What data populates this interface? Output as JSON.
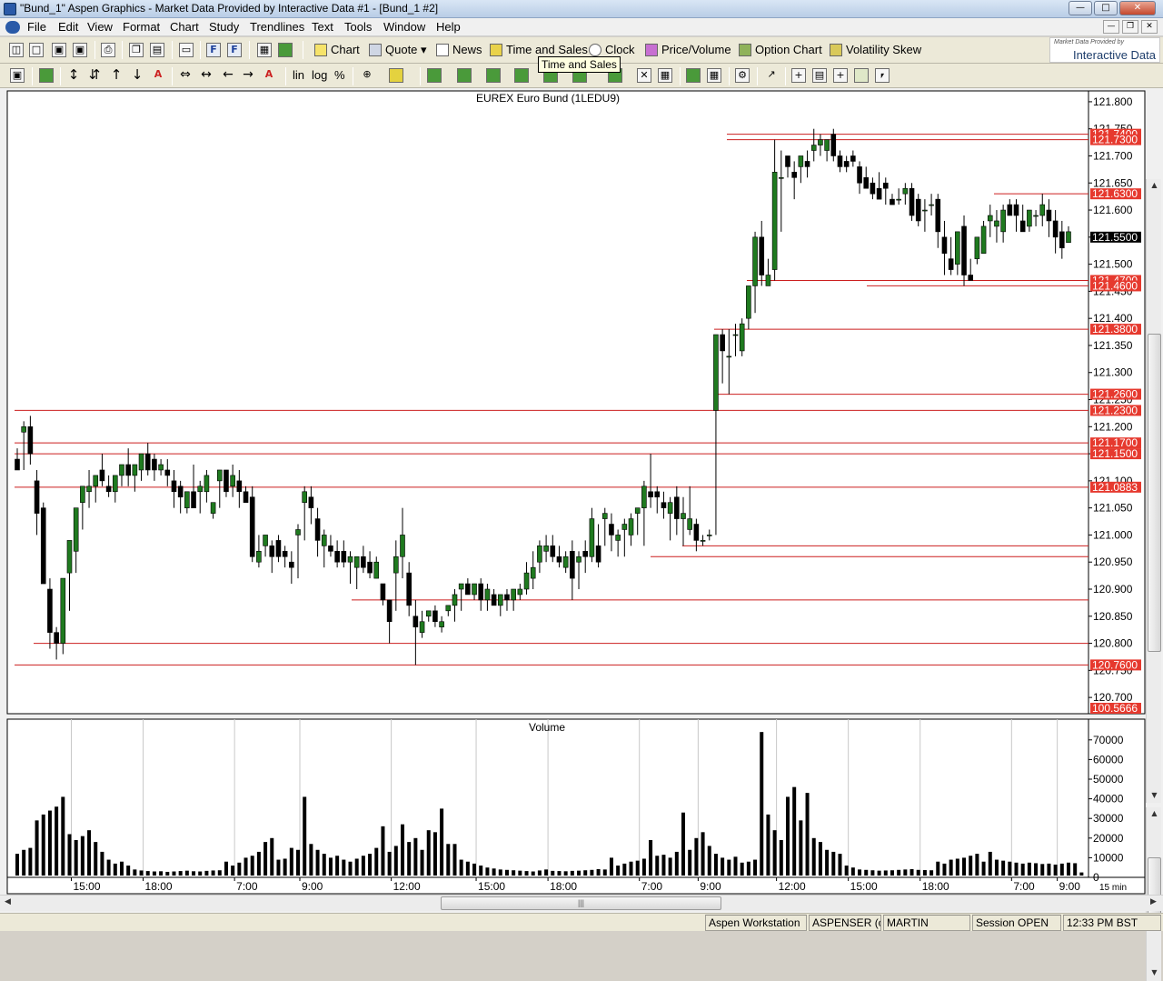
{
  "window": {
    "title": "\"Bund_1\" Aspen Graphics - Market Data Provided by Interactive Data #1 - [Bund_1 #2]"
  },
  "menu": [
    "File",
    "Edit",
    "View",
    "Format",
    "Chart",
    "Study",
    "Trendlines",
    "Text",
    "Tools",
    "Window",
    "Help"
  ],
  "toolbar": {
    "buttons": [
      "Chart",
      "Quote",
      "News",
      "Time and Sales",
      "Clock",
      "Price/Volume",
      "Option Chart",
      "Volatility Skew"
    ],
    "scale_lin": "lin",
    "scale_log": "log",
    "scale_pct": "%"
  },
  "logo": {
    "small": "Market Data Provided by",
    "big": "Interactive Data"
  },
  "tooltip": "Time and Sales",
  "colors": {
    "up": "#1f7a1f",
    "down": "#000000",
    "level": "#cc1f1f",
    "label_bg": "#e6392e",
    "current_bg": "#000000"
  },
  "chart_data": [
    {
      "type": "candlestick",
      "title": "EUREX  Euro  Bund  (1LEDU9)",
      "ylim": [
        120.67,
        121.82
      ],
      "yticks": [
        "121.800",
        "121.750",
        "121.700",
        "121.650",
        "121.600",
        "121.550",
        "121.500",
        "121.450",
        "121.400",
        "121.350",
        "121.300",
        "121.250",
        "121.200",
        "121.150",
        "121.100",
        "121.050",
        "121.000",
        "120.950",
        "120.900",
        "120.850",
        "120.800",
        "120.750",
        "120.700"
      ],
      "levels": [
        "121.7400",
        "121.7300",
        "121.6300",
        "121.4700",
        "121.4600",
        "121.3800",
        "121.2600",
        "121.2300",
        "121.1700",
        "121.1500",
        "121.0883",
        "120.7600"
      ],
      "current": "121.5500",
      "bottom_label": "100.5666",
      "open": [
        121.14,
        121.19,
        121.2,
        121.1,
        121.05,
        120.9,
        120.82,
        120.8,
        120.93,
        120.97,
        121.06,
        121.08,
        121.09,
        121.12,
        121.09,
        121.08,
        121.11,
        121.13,
        121.11,
        121.12,
        121.15,
        121.14,
        121.12,
        121.12,
        121.1,
        121.09,
        121.05,
        121.08,
        121.08,
        121.08,
        121.04,
        121.1,
        121.12,
        121.09,
        121.1,
        121.08,
        121.07,
        120.95,
        120.98,
        120.98,
        120.99,
        120.97,
        120.95,
        121.0,
        121.06,
        121.07,
        121.03,
        120.98,
        120.98,
        120.97,
        120.97,
        120.95,
        120.94,
        120.96,
        120.95,
        120.92,
        120.91,
        120.88,
        120.93,
        120.96,
        120.93,
        120.85,
        120.82,
        120.85,
        120.86,
        120.83,
        120.86,
        120.87,
        120.9,
        120.91,
        120.89,
        120.91,
        120.88,
        120.89,
        120.87,
        120.89,
        120.88,
        120.89,
        120.9,
        120.92,
        120.95,
        120.97,
        120.98,
        120.96,
        120.94,
        120.97,
        120.95,
        120.97,
        120.96,
        120.98,
        121.03,
        121.02,
        120.99,
        121.01,
        121.0,
        121.04,
        121.05,
        121.08,
        121.08,
        121.06,
        121.04,
        121.07,
        121.03,
        121.01,
        121.02,
        120.99,
        121.0,
        121.23,
        121.37,
        121.33,
        121.37,
        121.34,
        121.4,
        121.46,
        121.55,
        121.46,
        121.49,
        121.66,
        121.7,
        121.67,
        121.68,
        121.69,
        121.71,
        121.72,
        121.71,
        121.74,
        121.7,
        121.69,
        121.7,
        121.68,
        121.66,
        121.65,
        121.64,
        121.65,
        121.62,
        121.62,
        121.63,
        121.64,
        121.62,
        121.6,
        121.61,
        121.62,
        121.55,
        121.51,
        121.5,
        121.57,
        121.48,
        121.51,
        121.52,
        121.58,
        121.57,
        121.56,
        121.61,
        121.61,
        121.58,
        121.57,
        121.59,
        121.59,
        121.6,
        121.58,
        121.56,
        121.54
      ],
      "high": [
        121.16,
        121.21,
        121.22,
        121.12,
        121.06,
        120.92,
        120.83,
        120.82,
        120.95,
        120.98,
        121.09,
        121.12,
        121.1,
        121.15,
        121.11,
        121.1,
        121.13,
        121.16,
        121.13,
        121.13,
        121.17,
        121.15,
        121.14,
        121.14,
        121.12,
        121.1,
        121.06,
        121.13,
        121.1,
        121.12,
        121.06,
        121.12,
        121.12,
        121.13,
        121.12,
        121.09,
        121.09,
        121.0,
        120.99,
        120.99,
        121.0,
        120.98,
        120.97,
        121.02,
        121.09,
        121.09,
        121.05,
        121.01,
        121.0,
        120.99,
        120.99,
        120.97,
        120.96,
        120.98,
        120.97,
        120.96,
        120.91,
        120.88,
        120.99,
        121.05,
        120.95,
        120.88,
        120.86,
        120.86,
        120.87,
        120.85,
        120.87,
        120.9,
        120.91,
        120.92,
        120.91,
        120.92,
        120.91,
        120.9,
        120.89,
        120.9,
        120.9,
        120.91,
        120.95,
        120.97,
        120.99,
        121.0,
        121.0,
        120.98,
        120.97,
        120.99,
        120.97,
        120.99,
        121.05,
        121.02,
        121.05,
        121.04,
        121.01,
        121.03,
        121.04,
        121.05,
        121.1,
        121.15,
        121.09,
        121.08,
        121.07,
        121.09,
        121.07,
        121.09,
        121.03,
        121.0,
        121.01,
        121.35,
        121.38,
        121.38,
        121.39,
        121.4,
        121.46,
        121.56,
        121.58,
        121.51,
        121.73,
        121.71,
        121.7,
        121.69,
        121.7,
        121.71,
        121.75,
        121.74,
        121.73,
        121.75,
        121.71,
        121.7,
        121.71,
        121.69,
        121.68,
        121.66,
        121.67,
        121.66,
        121.63,
        121.64,
        121.65,
        121.65,
        121.63,
        121.62,
        121.63,
        121.63,
        121.58,
        121.55,
        121.55,
        121.59,
        121.51,
        121.54,
        121.58,
        121.61,
        121.6,
        121.61,
        121.62,
        121.62,
        121.61,
        121.6,
        121.6,
        121.63,
        121.62,
        121.6,
        121.58,
        121.57
      ],
      "low": [
        121.13,
        121.12,
        121.13,
        121.0,
        120.92,
        120.79,
        120.77,
        120.78,
        120.86,
        120.93,
        121.01,
        121.05,
        121.06,
        121.09,
        121.07,
        121.06,
        121.09,
        121.09,
        121.08,
        121.1,
        121.11,
        121.1,
        121.11,
        121.09,
        121.05,
        121.04,
        121.04,
        121.06,
        121.04,
        121.06,
        121.03,
        121.05,
        121.07,
        121.07,
        121.05,
        121.06,
        120.95,
        120.94,
        120.96,
        120.93,
        120.95,
        120.94,
        120.91,
        120.92,
        120.99,
        121.02,
        120.96,
        120.94,
        120.96,
        120.94,
        120.94,
        120.91,
        120.9,
        120.93,
        120.92,
        120.92,
        120.87,
        120.8,
        120.86,
        120.92,
        120.85,
        120.76,
        120.81,
        120.84,
        120.83,
        120.82,
        120.85,
        120.84,
        120.86,
        120.89,
        120.88,
        120.86,
        120.86,
        120.87,
        120.85,
        120.86,
        120.86,
        120.88,
        120.89,
        120.9,
        120.93,
        120.95,
        120.95,
        120.94,
        120.93,
        120.88,
        120.9,
        120.93,
        120.95,
        120.94,
        120.98,
        120.97,
        120.96,
        120.96,
        120.98,
        121.0,
        120.98,
        121.05,
        121.04,
        121.03,
        120.99,
        121.0,
        120.98,
        121.0,
        120.97,
        120.98,
        120.99,
        121.0,
        121.28,
        121.26,
        121.33,
        121.33,
        121.38,
        121.41,
        121.46,
        121.46,
        121.47,
        121.56,
        121.66,
        121.62,
        121.65,
        121.66,
        121.69,
        121.7,
        121.69,
        121.69,
        121.67,
        121.67,
        121.68,
        121.63,
        121.64,
        121.62,
        121.62,
        121.61,
        121.61,
        121.61,
        121.61,
        121.58,
        121.57,
        121.56,
        121.59,
        121.53,
        121.48,
        121.48,
        121.48,
        121.46,
        121.47,
        121.5,
        121.55,
        121.55,
        121.54,
        121.54,
        121.59,
        121.56,
        121.56,
        121.56,
        121.57,
        121.57,
        121.55,
        121.52,
        121.51,
        121.55
      ],
      "close": [
        121.12,
        121.2,
        121.15,
        121.04,
        120.91,
        120.82,
        120.8,
        120.92,
        120.99,
        121.05,
        121.09,
        121.09,
        121.11,
        121.1,
        121.08,
        121.11,
        121.13,
        121.11,
        121.13,
        121.15,
        121.12,
        121.12,
        121.13,
        121.11,
        121.08,
        121.07,
        121.08,
        121.05,
        121.09,
        121.11,
        121.06,
        121.12,
        121.08,
        121.11,
        121.08,
        121.06,
        120.96,
        120.97,
        121.0,
        120.96,
        120.96,
        120.96,
        120.94,
        121.01,
        121.08,
        121.05,
        120.99,
        121.0,
        120.97,
        120.95,
        120.95,
        120.96,
        120.96,
        120.94,
        120.93,
        120.95,
        120.88,
        120.84,
        120.96,
        121.0,
        120.87,
        120.83,
        120.84,
        120.86,
        120.84,
        120.84,
        120.87,
        120.89,
        120.91,
        120.89,
        120.91,
        120.88,
        120.9,
        120.87,
        120.89,
        120.88,
        120.9,
        120.9,
        120.93,
        120.94,
        120.98,
        120.98,
        120.96,
        120.95,
        120.96,
        120.92,
        120.96,
        120.96,
        121.03,
        120.95,
        121.04,
        121.0,
        121.0,
        121.02,
        121.03,
        121.05,
        121.09,
        121.07,
        121.07,
        121.05,
        121.06,
        121.03,
        121.04,
        121.03,
        120.99,
        120.99,
        121.0,
        121.37,
        121.34,
        121.33,
        121.37,
        121.39,
        121.46,
        121.55,
        121.48,
        121.48,
        121.67,
        121.66,
        121.68,
        121.66,
        121.7,
        121.68,
        121.72,
        121.73,
        121.73,
        121.7,
        121.68,
        121.68,
        121.69,
        121.65,
        121.64,
        121.63,
        121.62,
        121.64,
        121.61,
        121.62,
        121.64,
        121.59,
        121.58,
        121.6,
        121.61,
        121.56,
        121.52,
        121.49,
        121.56,
        121.48,
        121.47,
        121.55,
        121.57,
        121.59,
        121.58,
        121.6,
        121.59,
        121.59,
        121.56,
        121.6,
        121.59,
        121.61,
        121.58,
        121.55,
        121.53,
        121.56
      ]
    },
    {
      "type": "bar",
      "title": "Volume",
      "ylim": [
        0,
        75000
      ],
      "yticks": [
        "70000",
        "60000",
        "50000",
        "40000",
        "30000",
        "20000",
        "10000",
        "0"
      ],
      "values": [
        12000,
        14000,
        15000,
        29000,
        32000,
        34000,
        36000,
        41000,
        22000,
        19000,
        21000,
        24000,
        18000,
        13000,
        9000,
        7000,
        8000,
        6000,
        4000,
        3500,
        3200,
        3000,
        3100,
        2800,
        3000,
        3200,
        3400,
        3100,
        3000,
        3300,
        3500,
        3600,
        8000,
        6000,
        7500,
        10000,
        11000,
        13000,
        18000,
        20000,
        9000,
        9500,
        15000,
        14000,
        41000,
        17000,
        14000,
        12000,
        10000,
        11000,
        9000,
        8000,
        9500,
        11000,
        12000,
        15000,
        26000,
        13000,
        16000,
        27000,
        18000,
        20000,
        14000,
        24000,
        23000,
        35000,
        17000,
        17000,
        9000,
        8000,
        7000,
        6000,
        5000,
        4500,
        4000,
        3800,
        3600,
        3400,
        3200,
        3000,
        3500,
        4000,
        3300,
        3200,
        3100,
        3300,
        3400,
        3600,
        3800,
        4200,
        4000,
        10000,
        6000,
        7000,
        8000,
        8500,
        9500,
        19000,
        11000,
        11500,
        10000,
        13000,
        33000,
        14000,
        20000,
        23000,
        16000,
        12000,
        10000,
        9000,
        10500,
        7500,
        8000,
        9000,
        74000,
        32000,
        24000,
        19000,
        41000,
        46000,
        29000,
        43000,
        20000,
        18000,
        14000,
        13000,
        12000,
        6000,
        5000,
        4000,
        3800,
        3600,
        3400,
        3500,
        3600,
        3800,
        4000,
        4200,
        3800,
        3700,
        3600,
        8000,
        7000,
        9000,
        9500,
        10000,
        11000,
        12000,
        8000,
        13000,
        9000,
        8500,
        8000,
        7500,
        7000,
        7500,
        7200,
        6800,
        7000,
        6500,
        7000,
        7500,
        7200,
        2500
      ],
      "ylabel": ""
    }
  ],
  "x_axis": {
    "labels": [
      "15:00",
      "18:00",
      "7:00",
      "9:00",
      "12:00",
      "15:00",
      "18:00",
      "7:00",
      "9:00",
      "12:00",
      "15:00",
      "18:00",
      "7:00",
      "9:00"
    ],
    "interval": "15 min"
  },
  "status": [
    "Aspen Workstation",
    "ASPENSER (cs)",
    "MARTIN",
    "Session OPEN",
    "12:33 PM BST"
  ]
}
